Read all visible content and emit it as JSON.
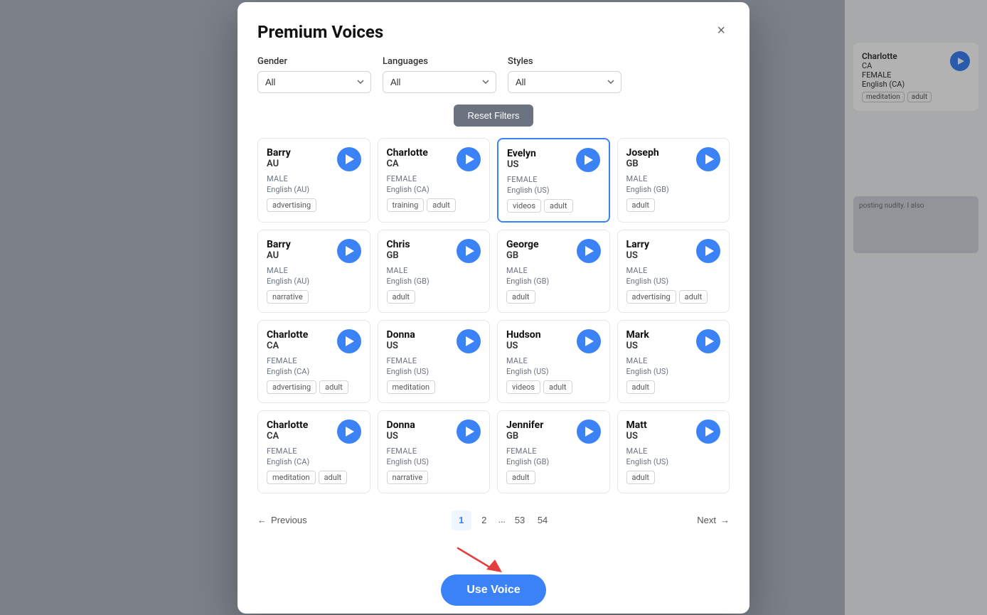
{
  "modal": {
    "title": "Premium Voices",
    "close_label": "×"
  },
  "filters": {
    "gender_label": "Gender",
    "gender_value": "All",
    "languages_label": "Languages",
    "languages_value": "All",
    "styles_label": "Styles",
    "styles_value": "All",
    "reset_label": "Reset Filters"
  },
  "voices": [
    {
      "name": "Barry",
      "country": "AU",
      "gender": "MALE",
      "language": "English (AU)",
      "tags": [
        "advertising"
      ],
      "selected": false
    },
    {
      "name": "Charlotte",
      "country": "CA",
      "gender": "FEMALE",
      "language": "English (CA)",
      "tags": [
        "training",
        "adult"
      ],
      "selected": false
    },
    {
      "name": "Evelyn",
      "country": "US",
      "gender": "FEMALE",
      "language": "English (US)",
      "tags": [
        "videos",
        "adult"
      ],
      "selected": true
    },
    {
      "name": "Joseph",
      "country": "GB",
      "gender": "MALE",
      "language": "English (GB)",
      "tags": [
        "adult"
      ],
      "selected": false
    },
    {
      "name": "Barry",
      "country": "AU",
      "gender": "MALE",
      "language": "English (AU)",
      "tags": [
        "narrative"
      ],
      "selected": false
    },
    {
      "name": "Chris",
      "country": "GB",
      "gender": "MALE",
      "language": "English (GB)",
      "tags": [
        "adult"
      ],
      "selected": false
    },
    {
      "name": "George",
      "country": "GB",
      "gender": "MALE",
      "language": "English (GB)",
      "tags": [
        "adult"
      ],
      "selected": false
    },
    {
      "name": "Larry",
      "country": "US",
      "gender": "MALE",
      "language": "English (US)",
      "tags": [
        "advertising",
        "adult"
      ],
      "selected": false
    },
    {
      "name": "Charlotte",
      "country": "CA",
      "gender": "FEMALE",
      "language": "English (CA)",
      "tags": [
        "advertising",
        "adult"
      ],
      "selected": false
    },
    {
      "name": "Donna",
      "country": "US",
      "gender": "FEMALE",
      "language": "English (US)",
      "tags": [
        "meditation"
      ],
      "selected": false
    },
    {
      "name": "Hudson",
      "country": "US",
      "gender": "MALE",
      "language": "English (US)",
      "tags": [
        "videos",
        "adult"
      ],
      "selected": false
    },
    {
      "name": "Mark",
      "country": "US",
      "gender": "MALE",
      "language": "English (US)",
      "tags": [
        "adult"
      ],
      "selected": false
    },
    {
      "name": "Charlotte",
      "country": "CA",
      "gender": "FEMALE",
      "language": "English (CA)",
      "tags": [
        "meditation",
        "adult"
      ],
      "selected": false
    },
    {
      "name": "Donna",
      "country": "US",
      "gender": "FEMALE",
      "language": "English (US)",
      "tags": [
        "narrative"
      ],
      "selected": false
    },
    {
      "name": "Jennifer",
      "country": "GB",
      "gender": "FEMALE",
      "language": "English (GB)",
      "tags": [
        "adult"
      ],
      "selected": false
    },
    {
      "name": "Matt",
      "country": "US",
      "gender": "MALE",
      "language": "English (US)",
      "tags": [
        "adult"
      ],
      "selected": false
    }
  ],
  "pagination": {
    "prev_label": "Previous",
    "next_label": "Next",
    "pages": [
      "1",
      "2",
      "...",
      "53",
      "54"
    ],
    "active_page": "1"
  },
  "use_voice_btn": "Use Voice",
  "background": {
    "right_card": {
      "name": "Charlotte",
      "country": "CA",
      "gender": "FEMALE",
      "language": "English (CA)",
      "tags": [
        "meditation",
        "adult"
      ]
    },
    "text_area_content": "posting nudity. I also"
  }
}
